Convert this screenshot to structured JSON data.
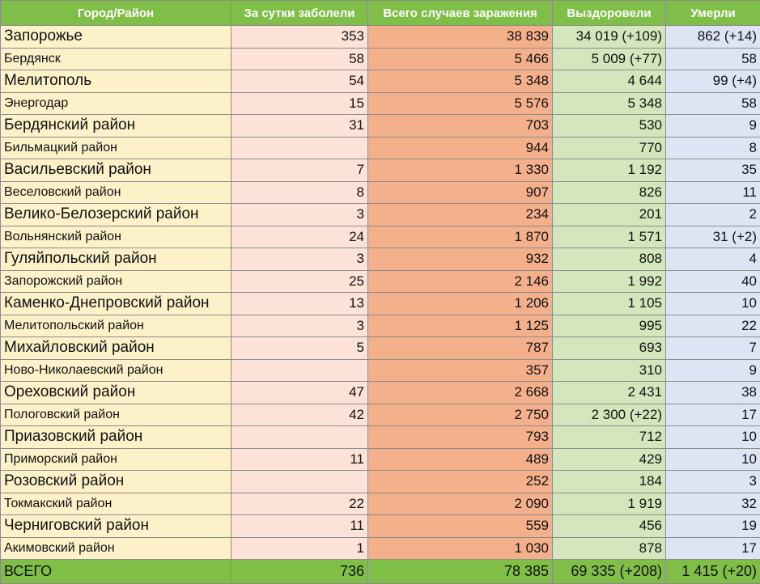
{
  "headers": {
    "city": "Город/Район",
    "daily": "За сутки заболели",
    "total": "Всего случаев заражения",
    "recovered": "Выздоровели",
    "died": "Умерли"
  },
  "rows": [
    {
      "city": "Запорожье",
      "daily": "353",
      "total": "38 839",
      "recovered": "34 019 (+109)",
      "died": "862 (+14)"
    },
    {
      "city": "Бердянск",
      "daily": "58",
      "total": "5 466",
      "recovered": "5 009 (+77)",
      "died": "58"
    },
    {
      "city": "Мелитополь",
      "daily": "54",
      "total": "5 348",
      "recovered": "4 644",
      "died": "99 (+4)"
    },
    {
      "city": "Энергодар",
      "daily": "15",
      "total": "5 576",
      "recovered": "5 348",
      "died": "58"
    },
    {
      "city": "Бердянский район",
      "daily": "31",
      "total": "703",
      "recovered": "530",
      "died": "9"
    },
    {
      "city": "Бильмацкий район",
      "daily": "",
      "total": "944",
      "recovered": "770",
      "died": "8"
    },
    {
      "city": "Васильевский район",
      "daily": "7",
      "total": "1 330",
      "recovered": "1 192",
      "died": "35"
    },
    {
      "city": "Веселовский район",
      "daily": "8",
      "total": "907",
      "recovered": "826",
      "died": "11"
    },
    {
      "city": "Велико-Белозерский район",
      "daily": "3",
      "total": "234",
      "recovered": "201",
      "died": "2"
    },
    {
      "city": "Вольнянский район",
      "daily": "24",
      "total": "1 870",
      "recovered": "1 571",
      "died": "31 (+2)"
    },
    {
      "city": "Гуляйпольский район",
      "daily": "3",
      "total": "932",
      "recovered": "808",
      "died": "4"
    },
    {
      "city": "Запорожский район",
      "daily": "25",
      "total": "2 146",
      "recovered": "1 992",
      "died": "40"
    },
    {
      "city": "Каменко-Днепровский район",
      "daily": "13",
      "total": "1 206",
      "recovered": "1 105",
      "died": "10"
    },
    {
      "city": "Мелитопольский район",
      "daily": "3",
      "total": "1 125",
      "recovered": "995",
      "died": "22"
    },
    {
      "city": "Михайловский район",
      "daily": "5",
      "total": "787",
      "recovered": "693",
      "died": "7"
    },
    {
      "city": "Ново-Николаевский район",
      "daily": "",
      "total": "357",
      "recovered": "310",
      "died": "9"
    },
    {
      "city": "Ореховский район",
      "daily": "47",
      "total": "2 668",
      "recovered": "2 431",
      "died": "38"
    },
    {
      "city": "Пологовский район",
      "daily": "42",
      "total": "2 750",
      "recovered": "2 300 (+22)",
      "died": "17"
    },
    {
      "city": "Приазовский район",
      "daily": "",
      "total": "793",
      "recovered": "712",
      "died": "10"
    },
    {
      "city": "Приморский район",
      "daily": "11",
      "total": "489",
      "recovered": "429",
      "died": "10"
    },
    {
      "city": "Розовский район",
      "daily": "",
      "total": "252",
      "recovered": "184",
      "died": "3"
    },
    {
      "city": "Токмакский район",
      "daily": "22",
      "total": "2 090",
      "recovered": "1 919",
      "died": "32"
    },
    {
      "city": "Черниговский район",
      "daily": "11",
      "total": "559",
      "recovered": "456",
      "died": "19"
    },
    {
      "city": "Акимовский район",
      "daily": "1",
      "total": "1 030",
      "recovered": "878",
      "died": "17"
    }
  ],
  "footer": {
    "label": "ВСЕГО",
    "daily": "736",
    "total": "78 385",
    "recovered": "69 335 (+208)",
    "died": "1 415 (+20)"
  },
  "colors": {
    "header_bg": "#7fbf47",
    "city_bg": "#fdf1c9",
    "daily_bg": "#fde3d7",
    "total_bg": "#f4b08a",
    "recovered_bg": "#d3e6bc",
    "died_bg": "#dde5f5"
  }
}
